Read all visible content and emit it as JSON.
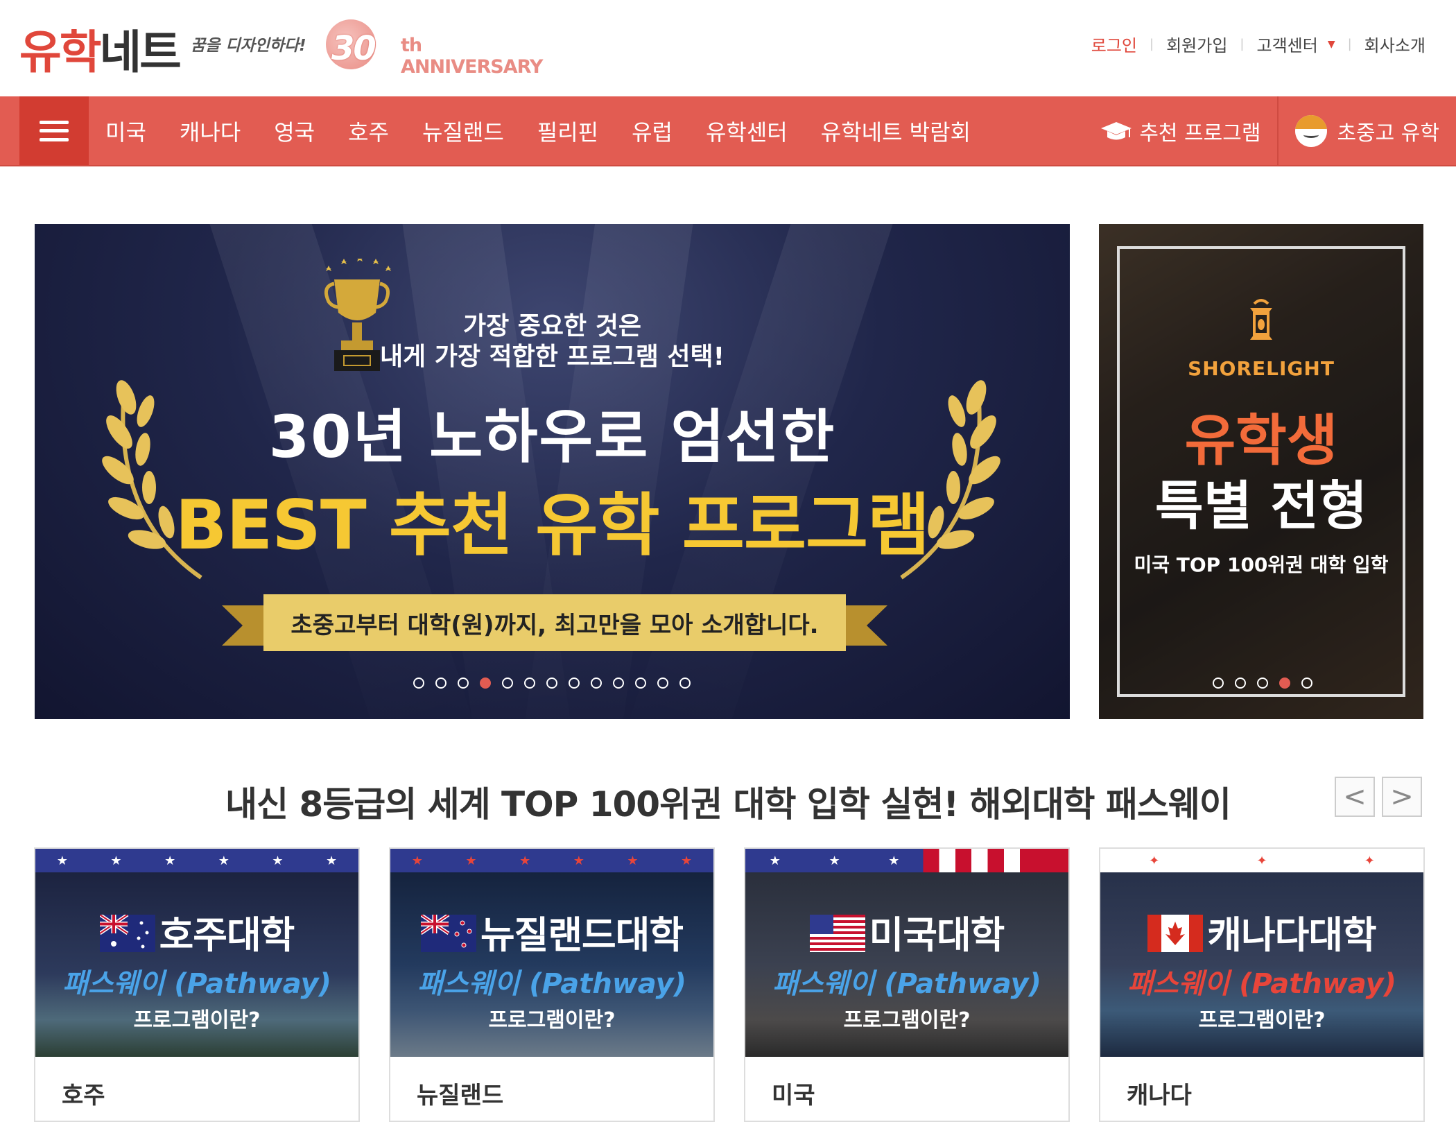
{
  "header": {
    "logo_part1": "유학",
    "logo_part2": "네트",
    "slogan": "꿈을 디자인하다!",
    "anniversary_number": "30",
    "anniversary_text": "th ANNIVERSARY",
    "util_links": {
      "login": "로그인",
      "signup": "회원가입",
      "customer_center": "고객센터",
      "about": "회사소개"
    }
  },
  "nav": {
    "items": [
      "미국",
      "캐나다",
      "영국",
      "호주",
      "뉴질랜드",
      "필리핀",
      "유럽",
      "유학센터",
      "유학네트 박람회"
    ],
    "recommended": "추천 프로그램",
    "k12": "초중고 유학"
  },
  "main_banner": {
    "subtitle_line1": "가장 중요한 것은",
    "subtitle_line2": "내게 가장 적합한 프로그램 선택!",
    "title_line1": "30년 노하우로 엄선한",
    "title_line2": "BEST 추천 유학 프로그램",
    "ribbon": "초중고부터 대학(원)까지, 최고만을 모아 소개합니다.",
    "slide_count": 13,
    "active_slide": 4
  },
  "side_banner": {
    "brand": "SHORELIGHT",
    "title_line1": "유학생",
    "title_line2": "특별 전형",
    "caption": "미국 TOP 100위권 대학 입학",
    "slide_count": 5,
    "active_slide": 4
  },
  "pathway": {
    "title": "내신 8등급의 세계 TOP 100위권 대학 입학 실현! 해외대학 패스웨이",
    "prev": "<",
    "next": ">",
    "cards": [
      {
        "title": "호주대학",
        "subtitle": "패스웨이 (Pathway)",
        "question": "프로그램이란?",
        "label": "호주",
        "stripe_color": "#2f3a8f",
        "subtitle_color": "#4aa3e8"
      },
      {
        "title": "뉴질랜드대학",
        "subtitle": "패스웨이 (Pathway)",
        "question": "프로그램이란?",
        "label": "뉴질랜드",
        "stripe_color": "#2f3a8f",
        "subtitle_color": "#4aa3e8"
      },
      {
        "title": "미국대학",
        "subtitle": "패스웨이 (Pathway)",
        "question": "프로그램이란?",
        "label": "미국",
        "stripe_color": "#2f3a8f",
        "subtitle_color": "#4aa3e8"
      },
      {
        "title": "캐나다대학",
        "subtitle": "패스웨이 (Pathway)",
        "question": "프로그램이란?",
        "label": "캐나다",
        "stripe_color": "#ffffff",
        "subtitle_color": "#e8453a"
      }
    ]
  }
}
